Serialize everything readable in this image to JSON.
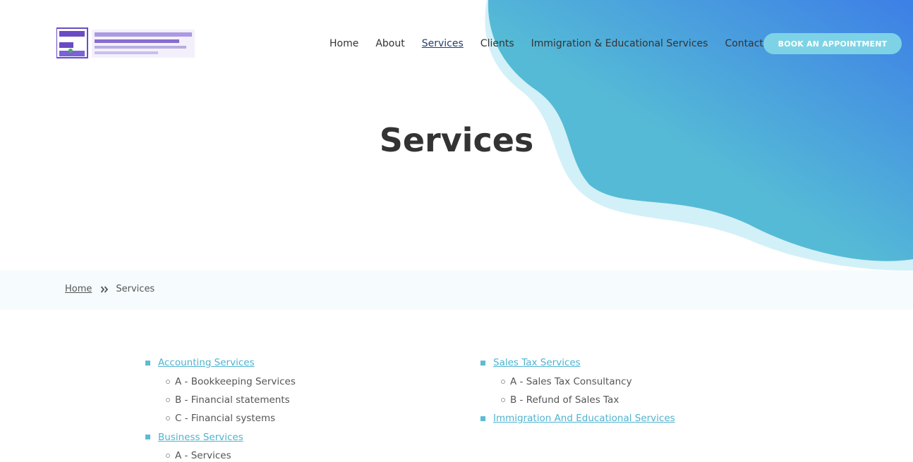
{
  "colors": {
    "blob_primary": "#55bad6",
    "blob_secondary": "#3d7fe6",
    "blob_light": "#cdeef6",
    "link": "#4fb3cf",
    "button_bg": "#7dd3e5",
    "active_nav": "#1f3f73"
  },
  "header": {
    "nav": [
      {
        "label": "Home",
        "active": false
      },
      {
        "label": "About",
        "active": false
      },
      {
        "label": "Services",
        "active": true
      },
      {
        "label": "Clients",
        "active": false
      },
      {
        "label": "Immigration & Educational Services",
        "active": false
      },
      {
        "label": "Contact",
        "active": false
      }
    ],
    "book_button": "BOOK AN APPOINTMENT"
  },
  "hero": {
    "title": "Services"
  },
  "breadcrumb": {
    "home": "Home",
    "current": "Services"
  },
  "services": {
    "left": [
      {
        "type": "link",
        "label": "Accounting Services"
      },
      {
        "type": "sub",
        "label": "A - Bookkeeping Services"
      },
      {
        "type": "sub",
        "label": "B - Financial statements"
      },
      {
        "type": "sub",
        "label": "C - Financial systems"
      },
      {
        "type": "link",
        "label": "Business Services"
      },
      {
        "type": "sub",
        "label": "A - Services"
      }
    ],
    "right": [
      {
        "type": "link",
        "label": "Sales Tax Services"
      },
      {
        "type": "sub",
        "label": "A - Sales Tax Consultancy"
      },
      {
        "type": "sub",
        "label": "B - Refund of Sales Tax"
      },
      {
        "type": "link",
        "label": "Immigration And Educational Services"
      }
    ]
  }
}
